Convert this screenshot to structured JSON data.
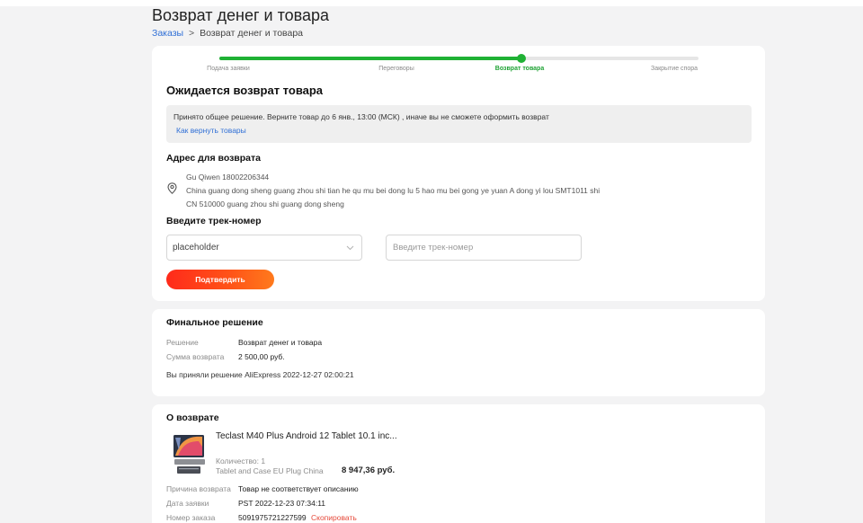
{
  "page": {
    "title": "Возврат денег и товара",
    "breadcrumb": {
      "parent": "Заказы",
      "separator": ">",
      "current": "Возврат денег и товара"
    }
  },
  "progress": {
    "steps": [
      "Подача заявки",
      "Переговоры",
      "Возврат товара",
      "Закрытие спора"
    ],
    "active_index": 2,
    "fill_fraction": 0.63,
    "color": "#1fb134"
  },
  "status": {
    "heading": "Ожидается возврат товара",
    "notice": "Принято общее решение. Верните товар до 6 янв., 13:00 (МСК) , иначе вы не сможете оформить возврат",
    "notice_link": "Как вернуть товары"
  },
  "return_address": {
    "heading": "Адрес для возврата",
    "icon": "location-pin-icon",
    "lines": [
      "Gu Qiwen 18002206344",
      "China guang dong sheng guang zhou shi tian he qu mu bei dong lu 5 hao mu bei gong ye yuan A dong yi lou SMT1011 shi",
      "CN 510000 guang zhou shi guang dong sheng"
    ]
  },
  "tracking": {
    "heading": "Введите трек-номер",
    "carrier_select_value": "placeholder",
    "track_input_placeholder": "Введите трек-номер",
    "track_input_value": "",
    "confirm_button": "Подтвердить",
    "button_color": "#ff4a1a"
  },
  "final_decision": {
    "heading": "Финальное решение",
    "rows": [
      {
        "label": "Решение",
        "value": "Возврат денег и товара"
      },
      {
        "label": "Сумма возврата",
        "value": "2 500,00 руб."
      }
    ],
    "accepted_text": "Вы приняли решение AliExpress 2022-12-27 02:00:21"
  },
  "about_return": {
    "heading": "О возврате",
    "product": {
      "title": "Teclast M40 Plus Android 12 Tablet 10.1 inc...",
      "quantity": "Количество: 1",
      "variant": "Tablet and Case EU Plug China",
      "price": "8 947,36 руб."
    },
    "rows": [
      {
        "label": "Причина возврата",
        "value": "Товар не соответствует описанию"
      },
      {
        "label": "Дата заявки",
        "value": "PST 2022-12-23 07:34:11"
      },
      {
        "label": "Номер заказа",
        "value": "5091975721227599"
      }
    ],
    "copy_link": "Скопировать"
  }
}
